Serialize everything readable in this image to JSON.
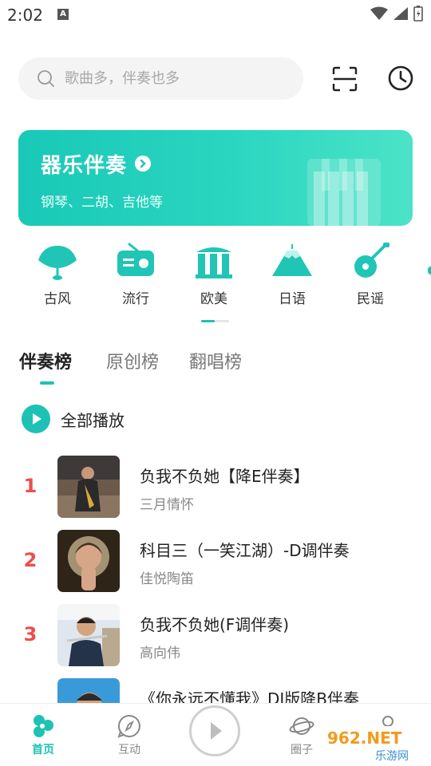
{
  "status": {
    "time": "2:02",
    "notif_letter": "A"
  },
  "search": {
    "placeholder": "歌曲多，伴奏也多"
  },
  "banner": {
    "title": "器乐伴奏",
    "subtitle": "钢琴、二胡、吉他等"
  },
  "categories": [
    {
      "label": "古风",
      "icon": "fan-icon"
    },
    {
      "label": "流行",
      "icon": "radio-icon"
    },
    {
      "label": "欧美",
      "icon": "columns-icon"
    },
    {
      "label": "日语",
      "icon": "mountain-icon"
    },
    {
      "label": "民谣",
      "icon": "guitar-icon"
    }
  ],
  "tabs": [
    {
      "label": "伴奏榜",
      "active": true
    },
    {
      "label": "原创榜",
      "active": false
    },
    {
      "label": "翻唱榜",
      "active": false
    }
  ],
  "play_all": {
    "label": "全部播放"
  },
  "songs": [
    {
      "rank": "1",
      "title": "负我不负她【降E伴奏】",
      "artist": "三月情怀"
    },
    {
      "rank": "2",
      "title": "科目三（一笑江湖）-D调伴奏",
      "artist": "佳悦陶笛"
    },
    {
      "rank": "3",
      "title": "负我不负她(F调伴奏)",
      "artist": "高向伟"
    },
    {
      "rank": "",
      "title": "《你永远不懂我》DJ版降B伴奏",
      "artist": ""
    }
  ],
  "bottom_nav": [
    {
      "label": "首页",
      "active": true
    },
    {
      "label": "互动",
      "active": false
    },
    {
      "label": "圈子",
      "active": false
    },
    {
      "label": "",
      "active": false
    }
  ],
  "watermark": {
    "line1": "962.NET",
    "line2": "乐游网"
  },
  "colors": {
    "accent": "#1ec2b4",
    "rank": "#ee4d4d"
  }
}
